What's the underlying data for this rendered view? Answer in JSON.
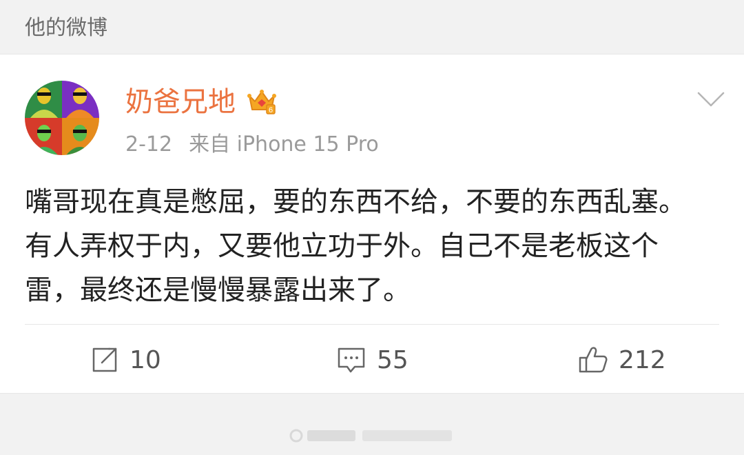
{
  "section": {
    "title": "他的微博"
  },
  "post": {
    "username": "奶爸兄地",
    "date": "2-12",
    "source": "来自 iPhone 15 Pro",
    "text": "嘴哥现在真是憋屈，要的东西不给，不要的东西乱塞。\n有人弄权于内，又要他立功于外。自己不是老板这个\n雷，最终还是慢慢暴露出来了。",
    "colors": {
      "username": "#eb7340",
      "badge": "#f5a623"
    },
    "icons": {
      "badge": "vip-crown-icon",
      "menu": "chevron-down-icon"
    }
  },
  "actions": {
    "repost": {
      "count": "10",
      "icon": "repost-icon"
    },
    "comment": {
      "count": "55",
      "icon": "comment-icon"
    },
    "like": {
      "count": "212",
      "icon": "thumbs-up-icon"
    }
  }
}
